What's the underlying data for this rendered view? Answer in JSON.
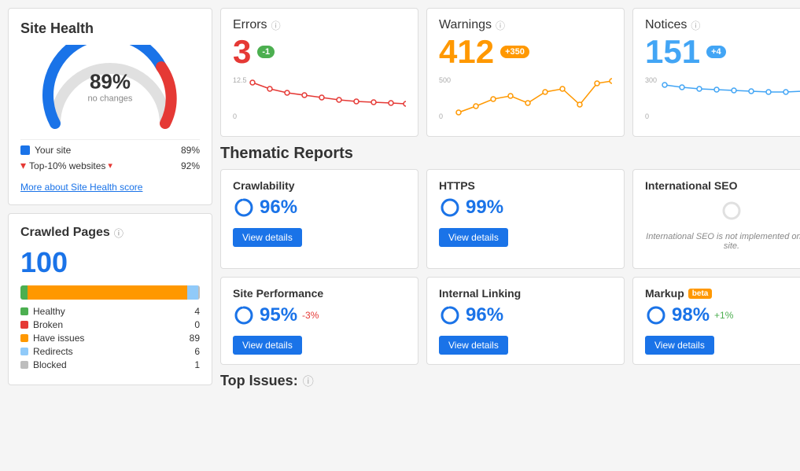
{
  "leftPanel": {
    "siteHealth": {
      "title": "Site Health",
      "percent": "89%",
      "label": "no changes",
      "legend": [
        {
          "label": "Your site",
          "value": "89%",
          "color": "#1a73e8",
          "shape": "square"
        },
        {
          "label": "Top-10% websites",
          "value": "92%",
          "color": "#e53935",
          "shape": "arrow"
        }
      ],
      "moreLink": "More about Site Health score"
    },
    "crawledPages": {
      "title": "Crawled Pages",
      "count": "100",
      "bars": [
        {
          "label": "Healthy",
          "value": 4,
          "pct": 4,
          "color": "#4caf50"
        },
        {
          "label": "Broken",
          "value": 0,
          "pct": 0,
          "color": "#e53935"
        },
        {
          "label": "Have issues",
          "value": 89,
          "pct": 89,
          "color": "#ff9800"
        },
        {
          "label": "Redirects",
          "value": 6,
          "pct": 6,
          "color": "#90caf9"
        },
        {
          "label": "Blocked",
          "value": 1,
          "pct": 1,
          "color": "#bdbdbd"
        }
      ]
    }
  },
  "stats": [
    {
      "title": "Errors",
      "number": "3",
      "badge": "-1",
      "badgeClass": "badge-green",
      "numberClass": "stat-number-errors",
      "chartColor": "#e53935",
      "chartMax": 12.5,
      "chartMin": 0,
      "points": [
        0.85,
        0.7,
        0.65,
        0.6,
        0.55,
        0.5,
        0.48,
        0.45,
        0.44,
        0.43
      ]
    },
    {
      "title": "Warnings",
      "number": "412",
      "badge": "+350",
      "badgeClass": "badge-orange",
      "numberClass": "stat-number-warnings",
      "chartColor": "#ff9800",
      "chartMax": 500,
      "chartMin": 0,
      "points": [
        0.12,
        0.2,
        0.3,
        0.35,
        0.25,
        0.4,
        0.45,
        0.2,
        0.55,
        0.85
      ]
    },
    {
      "title": "Notices",
      "number": "151",
      "badge": "+4",
      "badgeClass": "badge-blue",
      "numberClass": "stat-number-notices",
      "chartColor": "#42a5f5",
      "chartMax": 300,
      "chartMin": 0,
      "points": [
        0.7,
        0.65,
        0.62,
        0.6,
        0.58,
        0.57,
        0.56,
        0.56,
        0.57,
        0.56
      ]
    }
  ],
  "thematic": {
    "title": "Thematic Reports",
    "reports": [
      {
        "title": "Crawlability",
        "score": "96%",
        "change": null,
        "hasButton": true,
        "desc": null
      },
      {
        "title": "HTTPS",
        "score": "99%",
        "change": null,
        "hasButton": true,
        "desc": null
      },
      {
        "title": "International SEO",
        "score": null,
        "change": null,
        "hasButton": false,
        "desc": "International SEO is not implemented on this site."
      },
      {
        "title": "Site Performance",
        "score": "95%",
        "change": "-3%",
        "changeClass": "score-change-neg",
        "hasButton": true,
        "desc": null
      },
      {
        "title": "Internal Linking",
        "score": "96%",
        "change": null,
        "hasButton": true,
        "desc": null
      },
      {
        "title": "Markup",
        "score": "98%",
        "change": "+1%",
        "changeClass": "score-change-pos",
        "hasButton": true,
        "desc": null,
        "beta": true
      }
    ],
    "viewDetailsLabel": "View details"
  },
  "topIssues": {
    "title": "Top Issues:"
  },
  "infoIcon": "ⓘ"
}
